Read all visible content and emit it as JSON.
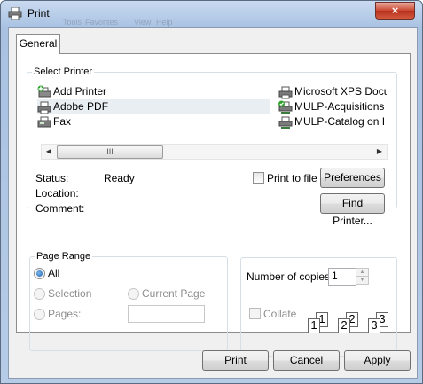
{
  "window": {
    "title": "Print",
    "close_label": "×",
    "bg_menu_text": [
      "Tools",
      "Favorites",
      "View",
      "Help"
    ]
  },
  "tabs": [
    {
      "label": "General"
    }
  ],
  "select_printer": {
    "legend": "Select Printer",
    "printers": [
      {
        "name": "Add Printer",
        "icon": "add-printer-icon"
      },
      {
        "name": "Adobe PDF",
        "icon": "printer-icon",
        "selected": true
      },
      {
        "name": "Fax",
        "icon": "fax-icon"
      },
      {
        "name": "Microsoft XPS Docu",
        "icon": "printer-icon"
      },
      {
        "name": "MULP-Acquisitions",
        "icon": "network-printer-default-icon"
      },
      {
        "name": "MULP-Catalog on I",
        "icon": "network-printer-icon"
      }
    ],
    "scroll_left": "◀",
    "scroll_right": "▶",
    "scroll_thumb_grip": "III"
  },
  "status": {
    "status_label": "Status:",
    "status_value": "Ready",
    "location_label": "Location:",
    "location_value": "",
    "comment_label": "Comment:",
    "comment_value": "",
    "print_to_file_label": "Print to file",
    "preferences_label": "Preferences",
    "find_printer_label": "Find Printer..."
  },
  "page_range": {
    "legend": "Page Range",
    "all_label": "All",
    "selection_label": "Selection",
    "current_page_label": "Current Page",
    "pages_label": "Pages:",
    "pages_value": ""
  },
  "copies": {
    "label": "Number of copies:",
    "value": "1",
    "collate_label": "Collate",
    "spin_up": "▲",
    "spin_down": "▼",
    "collate_pages": [
      "1",
      "1",
      "2",
      "2",
      "3",
      "3"
    ]
  },
  "buttons": {
    "print": "Print",
    "cancel": "Cancel",
    "apply": "Apply"
  },
  "colors": {
    "title_bar": "#b6cbe6",
    "close_button": "#c9452e",
    "selected_row": "#e9eef3"
  }
}
